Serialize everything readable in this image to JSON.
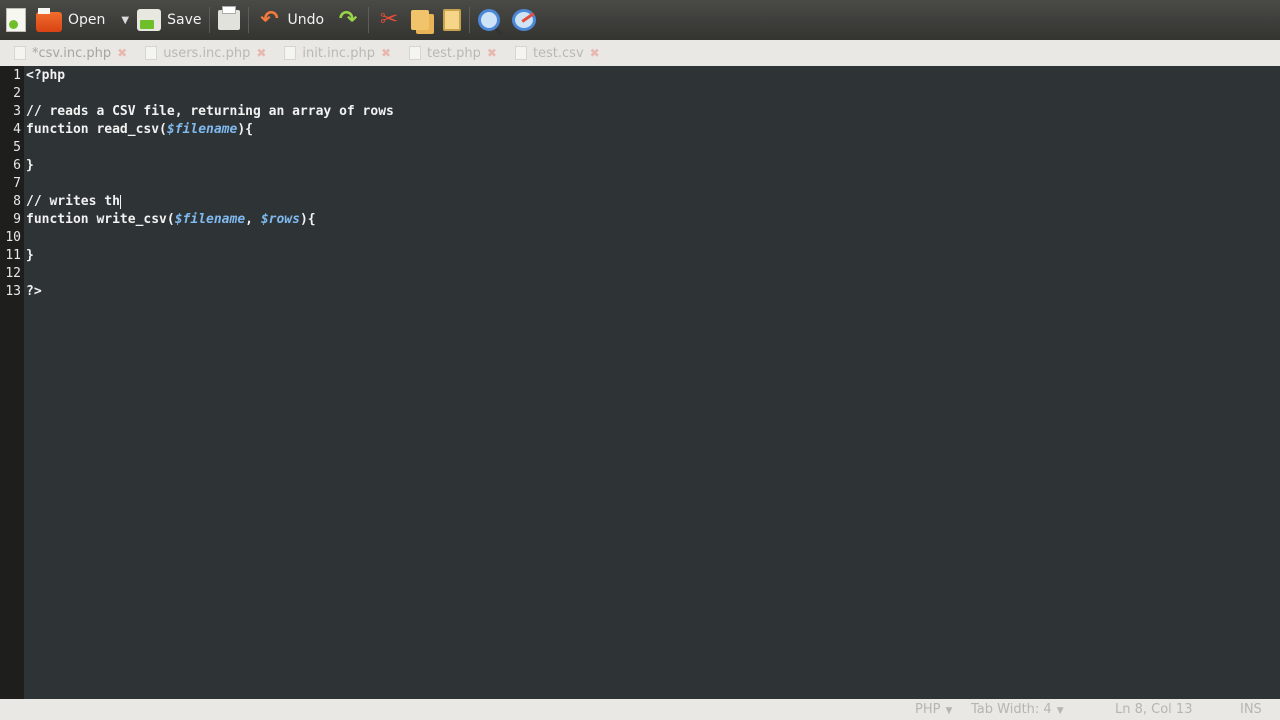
{
  "toolbar": {
    "open_label": "Open",
    "save_label": "Save",
    "undo_label": "Undo"
  },
  "tabs": [
    {
      "label": "*csv.inc.php",
      "active": true
    },
    {
      "label": "users.inc.php",
      "active": false
    },
    {
      "label": "init.inc.php",
      "active": false
    },
    {
      "label": "test.php",
      "active": false
    },
    {
      "label": "test.csv",
      "active": false
    }
  ],
  "editor": {
    "line_numbers": [
      "1",
      "2",
      "3",
      "4",
      "5",
      "6",
      "7",
      "8",
      "9",
      "10",
      "11",
      "12",
      "13"
    ],
    "lines": [
      {
        "parts": [
          {
            "t": "<?php",
            "c": "plain"
          }
        ]
      },
      {
        "parts": []
      },
      {
        "parts": [
          {
            "t": "// reads a CSV file, returning an array of rows",
            "c": "plain"
          }
        ]
      },
      {
        "parts": [
          {
            "t": "function read_csv(",
            "c": "plain"
          },
          {
            "t": "$filename",
            "c": "var"
          },
          {
            "t": "){",
            "c": "plain"
          }
        ]
      },
      {
        "parts": []
      },
      {
        "parts": [
          {
            "t": "}",
            "c": "plain"
          }
        ]
      },
      {
        "parts": []
      },
      {
        "parts": [
          {
            "t": "// writes th",
            "c": "plain"
          }
        ],
        "cursor": true
      },
      {
        "parts": [
          {
            "t": "function write_csv(",
            "c": "plain"
          },
          {
            "t": "$filename",
            "c": "var"
          },
          {
            "t": ", ",
            "c": "plain"
          },
          {
            "t": "$rows",
            "c": "var"
          },
          {
            "t": "){",
            "c": "plain"
          }
        ]
      },
      {
        "parts": []
      },
      {
        "parts": [
          {
            "t": "}",
            "c": "plain"
          }
        ]
      },
      {
        "parts": []
      },
      {
        "parts": [
          {
            "t": "?>",
            "c": "plain"
          }
        ]
      }
    ]
  },
  "statusbar": {
    "language": "PHP",
    "tab_width": "Tab Width: 4",
    "position": "Ln 8, Col 13",
    "mode": "INS"
  },
  "colors": {
    "editor_bg": "#2e3436",
    "gutter_bg": "#1e1f1d",
    "variable": "#7fb9ef"
  }
}
